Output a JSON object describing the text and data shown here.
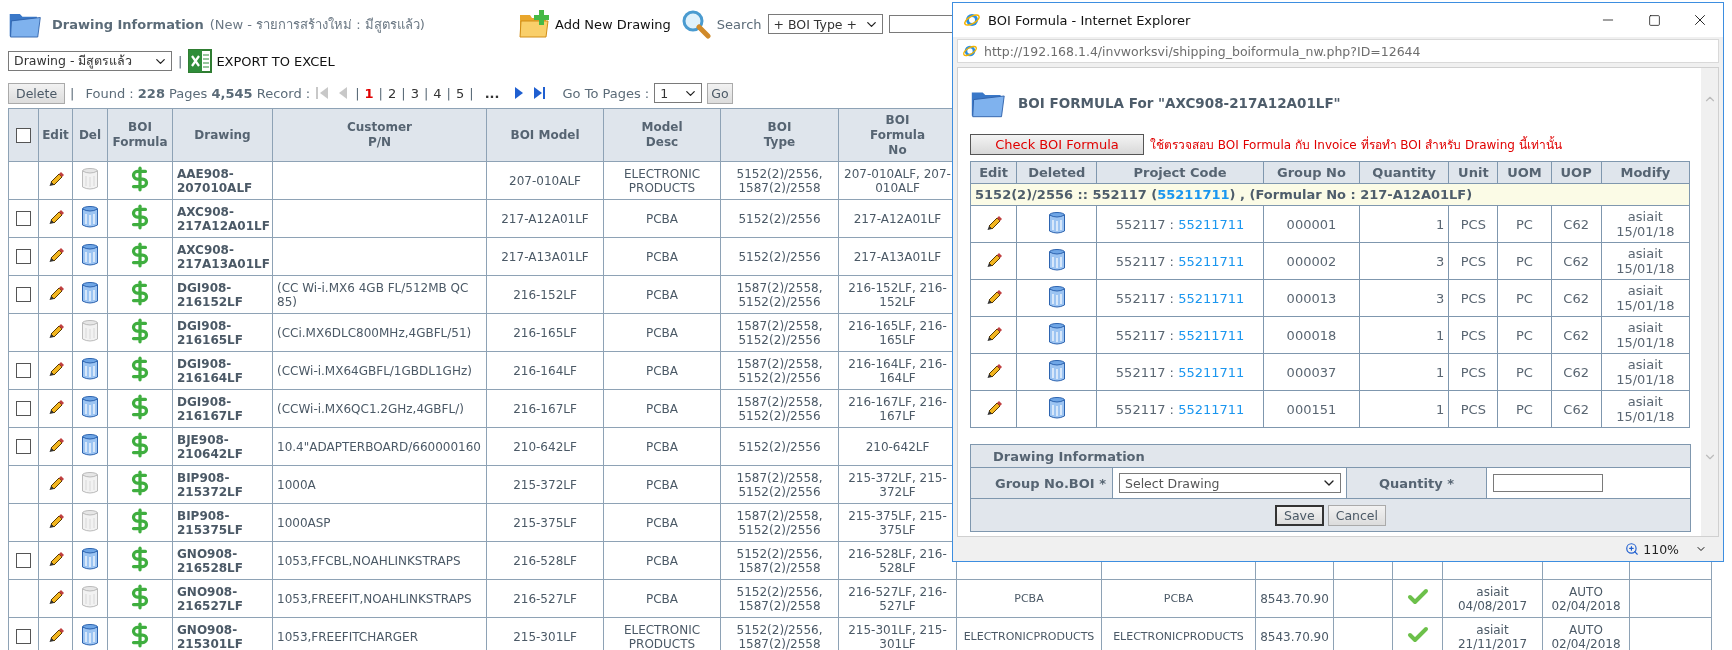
{
  "header": {
    "title": "Drawing Information",
    "subtitle": "(New - รายการสร้างใหม่ : มีสูตรแล้ว)",
    "add_button": "Add New Drawing",
    "search_label": "Search",
    "search_filter": "+ BOI Type +"
  },
  "toolbar": {
    "view_select": "Drawing - มีสูตรแล้ว",
    "separator": "|",
    "export_button": "EXPORT TO EXCEL"
  },
  "pager": {
    "delete_button": "Delete",
    "separator": "|",
    "summary": "Found : **228** Pages **4,545** Record :",
    "goto_label": "Go To Pages :",
    "goto_value": "1",
    "go_button": "Go",
    "items": [
      {
        "kind": "first",
        "disabled": true
      },
      {
        "kind": "prev",
        "disabled": true
      },
      {
        "kind": "sep",
        "text": "|"
      },
      {
        "kind": "page",
        "text": "1",
        "selected": true
      },
      {
        "kind": "sep",
        "text": "|"
      },
      {
        "kind": "page",
        "text": "2",
        "selected": false
      },
      {
        "kind": "sep",
        "text": "|"
      },
      {
        "kind": "page",
        "text": "3",
        "selected": false
      },
      {
        "kind": "sep",
        "text": "|"
      },
      {
        "kind": "page",
        "text": "4",
        "selected": false
      },
      {
        "kind": "sep",
        "text": "|"
      },
      {
        "kind": "page",
        "text": "5",
        "selected": false
      },
      {
        "kind": "sep",
        "text": "|"
      },
      {
        "kind": "more",
        "text": "..."
      },
      {
        "kind": "next",
        "disabled": false
      },
      {
        "kind": "last",
        "disabled": false
      }
    ]
  },
  "table": {
    "header_checkbox": {
      "checked": false
    },
    "columns": [
      "Edit",
      "Del",
      "BOI\nFormula",
      "Drawing",
      "Customer\nP/N",
      "BOI Model",
      "Model\nDesc",
      "BOI\nType",
      "BOI\nFormula\nNo"
    ],
    "rows": [
      {
        "deletable": false,
        "drawing": "AAE908-207010ALF",
        "boi_model": "207-010ALF",
        "model_desc": "ELECTRONIC PRODUCTS",
        "boi_type": "5152(2)/2556, 1587(2)/2558",
        "formula_no": "207-010ALF, 207-010ALF"
      },
      {
        "deletable": true,
        "checked": false,
        "drawing": "AXC908-217A12A01LF",
        "boi_model": "217-A12A01LF",
        "model_desc": "PCBA",
        "boi_type": "5152(2)/2556",
        "formula_no": "217-A12A01LF"
      },
      {
        "deletable": true,
        "checked": false,
        "drawing": "AXC908-217A13A01LF",
        "boi_model": "217-A13A01LF",
        "model_desc": "PCBA",
        "boi_type": "5152(2)/2556",
        "formula_no": "217-A13A01LF"
      },
      {
        "deletable": true,
        "checked": false,
        "drawing": "DGI908-216152LF",
        "customer_pn": "(CC Wi-i.MX6 4GB FL/512MB QC 85)",
        "boi_model": "216-152LF",
        "model_desc": "PCBA",
        "boi_type": "1587(2)/2558, 5152(2)/2556",
        "formula_no": "216-152LF, 216-152LF"
      },
      {
        "deletable": false,
        "drawing": "DGI908-216165LF",
        "customer_pn": "(CCi.MX6DLC800MHz,4GBFL/51)",
        "boi_model": "216-165LF",
        "model_desc": "PCBA",
        "boi_type": "1587(2)/2558, 5152(2)/2556",
        "formula_no": "216-165LF, 216-165LF"
      },
      {
        "deletable": true,
        "checked": false,
        "drawing": "DGI908-216164LF",
        "customer_pn": "(CCWi-i.MX64GBFL/1GBDL1GHz)",
        "boi_model": "216-164LF",
        "model_desc": "PCBA",
        "boi_type": "1587(2)/2558, 5152(2)/2556",
        "formula_no": "216-164LF, 216-164LF"
      },
      {
        "deletable": true,
        "checked": false,
        "drawing": "DGI908-216167LF",
        "customer_pn": "(CCWi-i.MX6QC1.2GHz,4GBFL/)",
        "boi_model": "216-167LF",
        "model_desc": "PCBA",
        "boi_type": "1587(2)/2558, 5152(2)/2556",
        "formula_no": "216-167LF, 216-167LF"
      },
      {
        "deletable": true,
        "checked": false,
        "drawing": "BJE908-210642LF",
        "customer_pn": "10.4\"ADAPTERBOARD/660000160",
        "boi_model": "210-642LF",
        "model_desc": "PCBA",
        "boi_type": "5152(2)/2556",
        "formula_no": "210-642LF"
      },
      {
        "deletable": false,
        "drawing": "BIP908-215372LF",
        "customer_pn": "1000A",
        "boi_model": "215-372LF",
        "model_desc": "PCBA",
        "boi_type": "1587(2)/2558, 5152(2)/2556",
        "formula_no": "215-372LF, 215-372LF"
      },
      {
        "deletable": false,
        "drawing": "BIP908-215375LF",
        "customer_pn": "1000ASP",
        "boi_model": "215-375LF",
        "model_desc": "PCBA",
        "boi_type": "1587(2)/2558, 5152(2)/2556",
        "formula_no": "215-375LF, 215-375LF"
      },
      {
        "deletable": true,
        "checked": false,
        "drawing": "GNO908-216528LF",
        "customer_pn": "1053,FFCBL,NOAHLINKSTRAPS",
        "boi_model": "216-528LF",
        "model_desc": "PCBA",
        "boi_type": "5152(2)/2556, 1587(2)/2558",
        "formula_no": "216-528LF, 216-528LF"
      },
      {
        "deletable": false,
        "drawing": "GNO908-216527LF",
        "customer_pn": "1053,FREEFIT,NOAHLINKSTRAPS",
        "boi_model": "216-527LF",
        "model_desc": "PCBA",
        "boi_type": "5152(2)/2556, 1587(2)/2558",
        "formula_no": "216-527LF, 216-527LF",
        "extra": {
          "column_11": "PCBA",
          "column_12": "PCBA",
          "column_13": "8543.70.90",
          "approved": true,
          "column_16": "asiait\n04/08/2017",
          "column_17": "AUTO\n02/04/2018"
        }
      },
      {
        "deletable": true,
        "checked": false,
        "drawing": "GNO908-215301LF",
        "customer_pn": "1053,FREEFITCHARGER",
        "boi_model": "215-301LF",
        "model_desc": "ELECTRONIC PRODUCTS",
        "boi_type": "5152(2)/2556, 1587(2)/2558",
        "formula_no": "215-301LF, 215-301LF",
        "extra": {
          "column_11": "ELECTRONICPRODUCTS",
          "column_12": "ELECTRONICPRODUCTS",
          "column_13": "8543.70.90",
          "approved": true,
          "column_16": "asiait\n21/11/2017",
          "column_17": "AUTO\n02/04/2018"
        }
      }
    ]
  },
  "popup": {
    "window_title": "BOI Formula - Internet Explorer",
    "url": "http://192.168.1.4/invworksvi/shipping_boiformula_nw.php?ID=12644",
    "heading": "BOI FORMULA For \"AXC908-217A12A01LF\"",
    "check_button": "Check BOI Formula",
    "note": "ใช้ตรวจสอบ BOI Formula กับ Invoice ที่รอทำ BOI สำหรับ Drawing นี้เท่านั้น",
    "columns": [
      "Edit",
      "Deleted",
      "Project Code",
      "Group No",
      "Quantity",
      "Unit",
      "UOM",
      "UOP",
      "Modify"
    ],
    "group": {
      "prefix": "5152(2)/2556 :: 552117 (",
      "link": "55211711",
      "suffix": ") , (Formular No : 217-A12A01LF)"
    },
    "rows": [
      {
        "project": "552117 :",
        "project_link": "55211711",
        "group_no": "000001",
        "quantity": "1",
        "unit": "PCS",
        "uom": "PC",
        "uop": "C62",
        "modify": "asiait\n15/01/18"
      },
      {
        "project": "552117 :",
        "project_link": "55211711",
        "group_no": "000002",
        "quantity": "3",
        "unit": "PCS",
        "uom": "PC",
        "uop": "C62",
        "modify": "asiait\n15/01/18"
      },
      {
        "project": "552117 :",
        "project_link": "55211711",
        "group_no": "000013",
        "quantity": "3",
        "unit": "PCS",
        "uom": "PC",
        "uop": "C62",
        "modify": "asiait\n15/01/18"
      },
      {
        "project": "552117 :",
        "project_link": "55211711",
        "group_no": "000018",
        "quantity": "1",
        "unit": "PCS",
        "uom": "PC",
        "uop": "C62",
        "modify": "asiait\n15/01/18"
      },
      {
        "project": "552117 :",
        "project_link": "55211711",
        "group_no": "000037",
        "quantity": "1",
        "unit": "PCS",
        "uom": "PC",
        "uop": "C62",
        "modify": "asiait\n15/01/18"
      },
      {
        "project": "552117 :",
        "project_link": "55211711",
        "group_no": "000151",
        "quantity": "1",
        "unit": "PCS",
        "uom": "PC",
        "uop": "C62",
        "modify": "asiait\n15/01/18"
      }
    ],
    "form": {
      "title": "Drawing Information",
      "group_label": "Group No.BOI *",
      "group_select": "Select Drawing",
      "quantity_label": "Quantity *",
      "save_button": "Save",
      "cancel_button": "Cancel"
    },
    "zoom": "110%"
  }
}
